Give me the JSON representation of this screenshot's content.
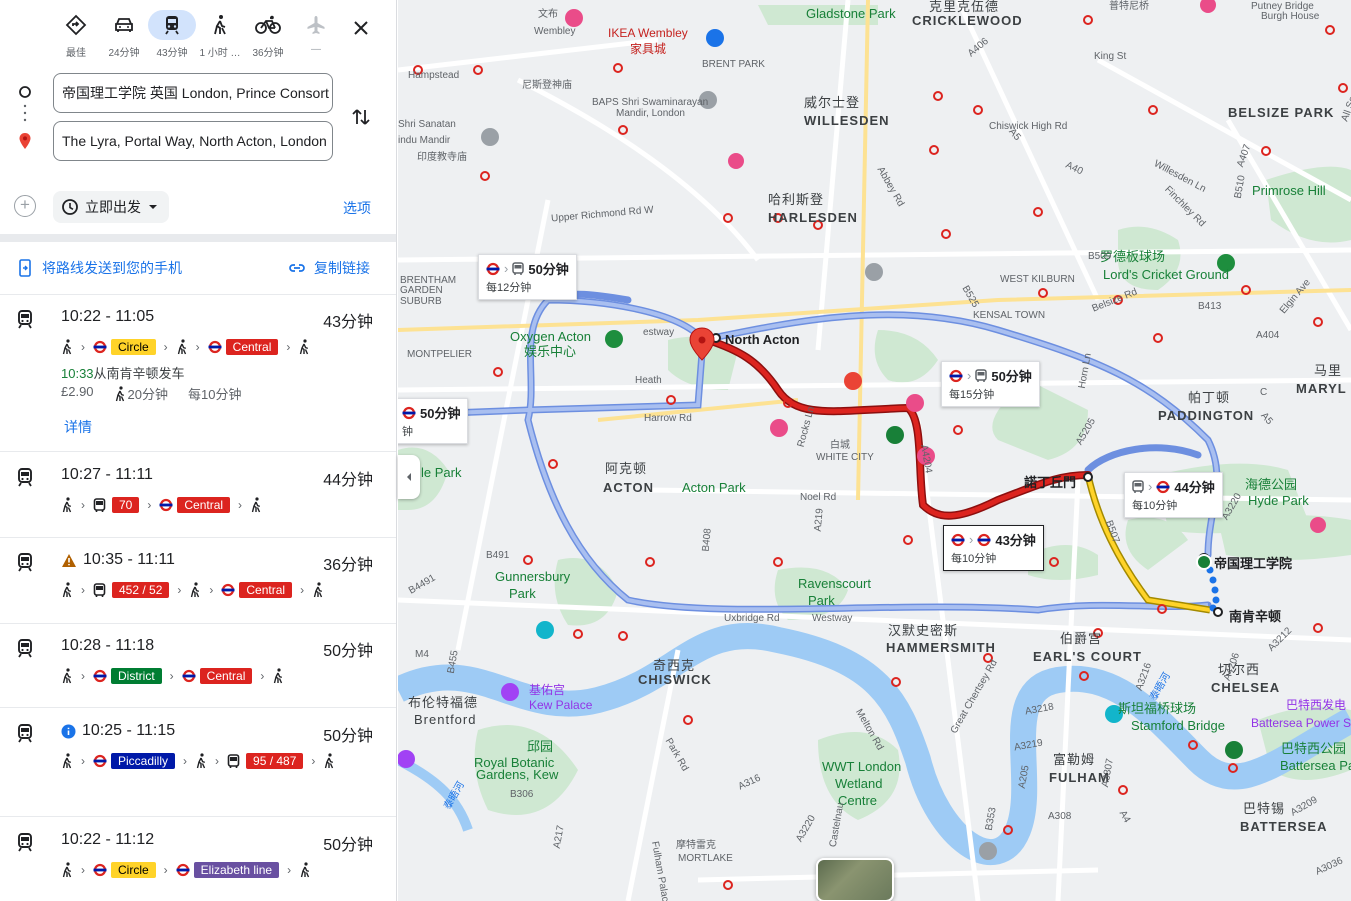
{
  "modes": [
    {
      "id": "best",
      "label": "最佳",
      "icon": "diamond-route-icon"
    },
    {
      "id": "drive",
      "label": "24分钟",
      "icon": "car-icon"
    },
    {
      "id": "transit",
      "label": "43分钟",
      "icon": "train-icon",
      "selected": true
    },
    {
      "id": "walk",
      "label": "1 小时 …",
      "icon": "walk-icon"
    },
    {
      "id": "bike",
      "label": "36分钟",
      "icon": "bike-icon"
    },
    {
      "id": "flight",
      "label": "—",
      "icon": "plane-icon",
      "disabled": true
    }
  ],
  "origin": {
    "value": "帝国理工学院 英国 London, Prince Consort"
  },
  "destination": {
    "value": "The Lyra, Portal Way, North Acton, London"
  },
  "depart": {
    "label": "立即出发",
    "options": "选项"
  },
  "share": {
    "send": "将路线发送到您的手机",
    "copy": "复制链接"
  },
  "routes": [
    {
      "time": "10:22 - 11:05",
      "duration": "43分钟",
      "steps": [
        {
          "t": "walk"
        },
        {
          "t": "ug",
          "name": "Circle",
          "bg": "#ffd329",
          "fg": "#000"
        },
        {
          "t": "walk"
        },
        {
          "t": "ug",
          "name": "Central",
          "bg": "#dc241f",
          "fg": "#fff"
        },
        {
          "t": "walk"
        }
      ],
      "depart_time": "10:33",
      "depart_from": "从南肯辛顿发车",
      "fare": "£2.90",
      "walk_time": "20分钟",
      "freq": "每10分钟",
      "details": "详情"
    },
    {
      "time": "10:27 - 11:11",
      "duration": "44分钟",
      "steps": [
        {
          "t": "walk"
        },
        {
          "t": "bus",
          "name": "70",
          "bg": "#dc241f",
          "fg": "#fff"
        },
        {
          "t": "ug",
          "name": "Central",
          "bg": "#dc241f",
          "fg": "#fff"
        },
        {
          "t": "walk"
        }
      ]
    },
    {
      "time": "10:35 - 11:11",
      "duration": "36分钟",
      "warning": true,
      "steps": [
        {
          "t": "walk"
        },
        {
          "t": "bus",
          "name": "452 / 52",
          "bg": "#dc241f",
          "fg": "#fff"
        },
        {
          "t": "walk"
        },
        {
          "t": "ug",
          "name": "Central",
          "bg": "#dc241f",
          "fg": "#fff"
        },
        {
          "t": "walk"
        }
      ]
    },
    {
      "time": "10:28 - 11:18",
      "duration": "50分钟",
      "steps": [
        {
          "t": "walk"
        },
        {
          "t": "ug",
          "name": "District",
          "bg": "#007d32",
          "fg": "#fff"
        },
        {
          "t": "ug",
          "name": "Central",
          "bg": "#dc241f",
          "fg": "#fff"
        },
        {
          "t": "walk"
        }
      ]
    },
    {
      "time": "10:25 - 11:15",
      "duration": "50分钟",
      "info": true,
      "steps": [
        {
          "t": "walk"
        },
        {
          "t": "ug",
          "name": "Piccadilly",
          "bg": "#0019a8",
          "fg": "#fff"
        },
        {
          "t": "walk"
        },
        {
          "t": "bus",
          "name": "95 / 487",
          "bg": "#dc241f",
          "fg": "#fff"
        },
        {
          "t": "walk"
        }
      ]
    },
    {
      "time": "10:22 - 11:12",
      "duration": "50分钟",
      "steps": [
        {
          "t": "walk"
        },
        {
          "t": "ug",
          "name": "Circle",
          "bg": "#ffd329",
          "fg": "#000"
        },
        {
          "t": "ug",
          "name": "Elizabeth line",
          "bg": "#6950a1",
          "fg": "#fff"
        },
        {
          "t": "walk"
        }
      ]
    }
  ],
  "map": {
    "callouts": [
      {
        "id": "c50a",
        "dur": "50分钟",
        "freq": "每12分钟",
        "kind": "ug-bus"
      },
      {
        "id": "c50b",
        "dur": "50分钟",
        "freq": "每15分钟",
        "kind": "ug-bus"
      },
      {
        "id": "c50c",
        "dur": "50分钟",
        "freq": "钟",
        "kind": "ug"
      },
      {
        "id": "c44",
        "dur": "44分钟",
        "freq": "每10分钟",
        "kind": "bus-ug"
      },
      {
        "id": "c43",
        "dur": "43分钟",
        "freq": "每10分钟",
        "kind": "ug-ug",
        "selected": true
      }
    ],
    "stations": {
      "north_acton": "North Acton",
      "imperial": "帝国理工学院",
      "south_ken": "南肯辛顿",
      "notting": "諾丁丘門"
    },
    "labels": [
      {
        "k": "dist",
        "t": "CRICKLEWOOD"
      },
      {
        "k": "area",
        "t": "克里克伍德"
      },
      {
        "k": "dist",
        "t": "WILLESDEN"
      },
      {
        "k": "area",
        "t": "威尔士登"
      },
      {
        "k": "dist",
        "t": "HARLESDEN"
      },
      {
        "k": "area",
        "t": "哈利斯登"
      },
      {
        "k": "dist",
        "t": "ACTON"
      },
      {
        "k": "area",
        "t": "阿克顿"
      },
      {
        "k": "dist",
        "t": "PADDINGTON"
      },
      {
        "k": "area",
        "t": "帕丁顿"
      },
      {
        "k": "dist",
        "t": "HAMMERSMITH"
      },
      {
        "k": "area",
        "t": "汉默史密斯"
      },
      {
        "k": "dist",
        "t": "EARL'S COURT"
      },
      {
        "k": "area",
        "t": "伯爵宫"
      },
      {
        "k": "dist",
        "t": "CHELSEA"
      },
      {
        "k": "area",
        "t": "切尔西"
      },
      {
        "k": "dist",
        "t": "FULHAM"
      },
      {
        "k": "area",
        "t": "富勒姆"
      },
      {
        "k": "dist",
        "t": "BATTERSEA"
      },
      {
        "k": "area",
        "t": "巴特锡"
      },
      {
        "k": "dist",
        "t": "CHISWICK"
      },
      {
        "k": "area",
        "t": "奇西克"
      },
      {
        "k": "dist",
        "t": "BELSIZE PARK"
      },
      {
        "k": "dist",
        "t": "MARYL"
      },
      {
        "k": "area",
        "t": "马里"
      },
      {
        "k": "area",
        "t": "布伦特福德"
      },
      {
        "k": "area",
        "t": "Brentford"
      },
      {
        "k": "sm",
        "t": "BRENT PARK"
      },
      {
        "k": "sm",
        "t": "WEST KILBURN"
      },
      {
        "k": "sm",
        "t": "KENSAL TOWN"
      },
      {
        "k": "sm",
        "t": "MONTPELIER"
      },
      {
        "k": "sm",
        "t": "WHITE CITY"
      },
      {
        "k": "sm",
        "t": "白城"
      },
      {
        "k": "sm",
        "t": "MORTLAKE"
      },
      {
        "k": "sm",
        "t": "摩特雷克"
      },
      {
        "k": "sm",
        "t": "BRENTHAM"
      },
      {
        "k": "sm",
        "t": "GARDEN"
      },
      {
        "k": "sm",
        "t": "SUBURB"
      },
      {
        "k": "park",
        "t": "Gladstone Park"
      },
      {
        "k": "park",
        "t": "Primrose Hill"
      },
      {
        "k": "park",
        "t": "Acton Park"
      },
      {
        "k": "park",
        "t": "Gunnersbury"
      },
      {
        "k": "park",
        "t": "Park"
      },
      {
        "k": "park",
        "t": "Ravenscourt"
      },
      {
        "k": "park",
        "t": "Park"
      },
      {
        "k": "park",
        "t": "Oxygen Acton"
      },
      {
        "k": "park",
        "t": "娱乐中心"
      },
      {
        "k": "park",
        "t": "罗德板球场"
      },
      {
        "k": "park",
        "t": "Lord's Cricket Ground"
      },
      {
        "k": "park",
        "t": "海德公园"
      },
      {
        "k": "park",
        "t": "Hyde Park"
      },
      {
        "k": "park",
        "t": "斯坦福桥球场"
      },
      {
        "k": "park",
        "t": "Stamford Bridge"
      },
      {
        "k": "park",
        "t": "巴特西公园"
      },
      {
        "k": "park",
        "t": "Battersea Park"
      },
      {
        "k": "park",
        "t": "WWT London"
      },
      {
        "k": "park",
        "t": "Wetland"
      },
      {
        "k": "park",
        "t": "Centre"
      },
      {
        "k": "park",
        "t": "邱园"
      },
      {
        "k": "park",
        "t": "Royal Botanic"
      },
      {
        "k": "park",
        "t": "Gardens, Kew"
      },
      {
        "k": "park",
        "t": "le Park"
      },
      {
        "k": "purp",
        "t": "基佑宫"
      },
      {
        "k": "purp",
        "t": "Kew Palace"
      },
      {
        "k": "purp",
        "t": "巴特西发电"
      },
      {
        "k": "purp",
        "t": "Battersea Power Sta"
      },
      {
        "k": "pink",
        "t": "IKEA Wembley"
      },
      {
        "k": "pink",
        "t": "家具城"
      },
      {
        "k": "sm",
        "t": "尼斯登神庙"
      },
      {
        "k": "sm",
        "t": "BAPS Shri Swaminarayan"
      },
      {
        "k": "sm",
        "t": "Mandir, London"
      },
      {
        "k": "sm",
        "t": "Shri Sanatan"
      },
      {
        "k": "sm",
        "t": "indu Mandir"
      },
      {
        "k": "sm",
        "t": "印度教寺庙"
      },
      {
        "k": "sm",
        "t": "文布"
      },
      {
        "k": "sm",
        "t": "Wembley"
      },
      {
        "k": "sm",
        "t": "普特尼桥"
      },
      {
        "k": "sm",
        "t": "Putney Bridge"
      },
      {
        "k": "sm",
        "t": "Burgh House"
      },
      {
        "k": "sm",
        "t": "Hampstead"
      },
      {
        "k": "sm",
        "t": "Heath"
      },
      {
        "k": "road",
        "t": "Harrow Rd"
      },
      {
        "k": "road",
        "t": "Noel Rd"
      },
      {
        "k": "road",
        "t": "Horn Ln"
      },
      {
        "k": "road",
        "t": "Uxbridge Rd"
      },
      {
        "k": "road",
        "t": "Westway"
      },
      {
        "k": "road",
        "t": "Chiswick High Rd"
      },
      {
        "k": "road",
        "t": "King St"
      },
      {
        "k": "road",
        "t": "Willesden Ln"
      },
      {
        "k": "road",
        "t": "Finchley Rd"
      },
      {
        "k": "road",
        "t": "Belsize Rd"
      },
      {
        "k": "road",
        "t": "Abbey Rd"
      },
      {
        "k": "road",
        "t": "Elgin Ave"
      },
      {
        "k": "road",
        "t": "All Souls Ave"
      },
      {
        "k": "road",
        "t": "Park Rd"
      },
      {
        "k": "road",
        "t": "Melton Rd"
      },
      {
        "k": "road",
        "t": "Great Chertsey Rd"
      },
      {
        "k": "road",
        "t": "Castelnau"
      },
      {
        "k": "road",
        "t": "Fulham Palace Rd"
      },
      {
        "k": "road",
        "t": "Rocks Ln"
      },
      {
        "k": "road",
        "t": "Upper Richmond Rd W"
      },
      {
        "k": "road",
        "t": "estway"
      },
      {
        "k": "road",
        "t": "A406"
      },
      {
        "k": "road",
        "t": "A40"
      },
      {
        "k": "road",
        "t": "A5"
      },
      {
        "k": "road",
        "t": "A407"
      },
      {
        "k": "road",
        "t": "B510"
      },
      {
        "k": "road",
        "t": "B509"
      },
      {
        "k": "road",
        "t": "B525"
      },
      {
        "k": "road",
        "t": "B413"
      },
      {
        "k": "road",
        "t": "A404"
      },
      {
        "k": "road",
        "t": "A5205"
      },
      {
        "k": "road",
        "t": "B507"
      },
      {
        "k": "road",
        "t": "A4206"
      },
      {
        "k": "road",
        "t": "A3220"
      },
      {
        "k": "road",
        "t": "A4204"
      },
      {
        "k": "road",
        "t": "A219"
      },
      {
        "k": "road",
        "t": "B408"
      },
      {
        "k": "road",
        "t": "B491"
      },
      {
        "k": "road",
        "t": "B4491"
      },
      {
        "k": "road",
        "t": "B455"
      },
      {
        "k": "road",
        "t": "M4"
      },
      {
        "k": "road",
        "t": "A3218"
      },
      {
        "k": "road",
        "t": "A3219"
      },
      {
        "k": "road",
        "t": "A308"
      },
      {
        "k": "road",
        "t": "A3216"
      },
      {
        "k": "road",
        "t": "A3212"
      },
      {
        "k": "road",
        "t": "A3036"
      },
      {
        "k": "road",
        "t": "A3209"
      },
      {
        "k": "road",
        "t": "A3307"
      },
      {
        "k": "road",
        "t": "A205"
      },
      {
        "k": "road",
        "t": "B353"
      },
      {
        "k": "road",
        "t": "B306"
      },
      {
        "k": "road",
        "t": "A316"
      },
      {
        "k": "road",
        "t": "A217"
      },
      {
        "k": "road",
        "t": "A3220"
      },
      {
        "k": "water",
        "t": "泰晤河"
      },
      {
        "k": "water",
        "t": "泰晤河"
      },
      {
        "k": "road",
        "t": "A4"
      },
      {
        "k": "road",
        "t": "A5"
      },
      {
        "k": "road",
        "t": "C"
      }
    ]
  }
}
